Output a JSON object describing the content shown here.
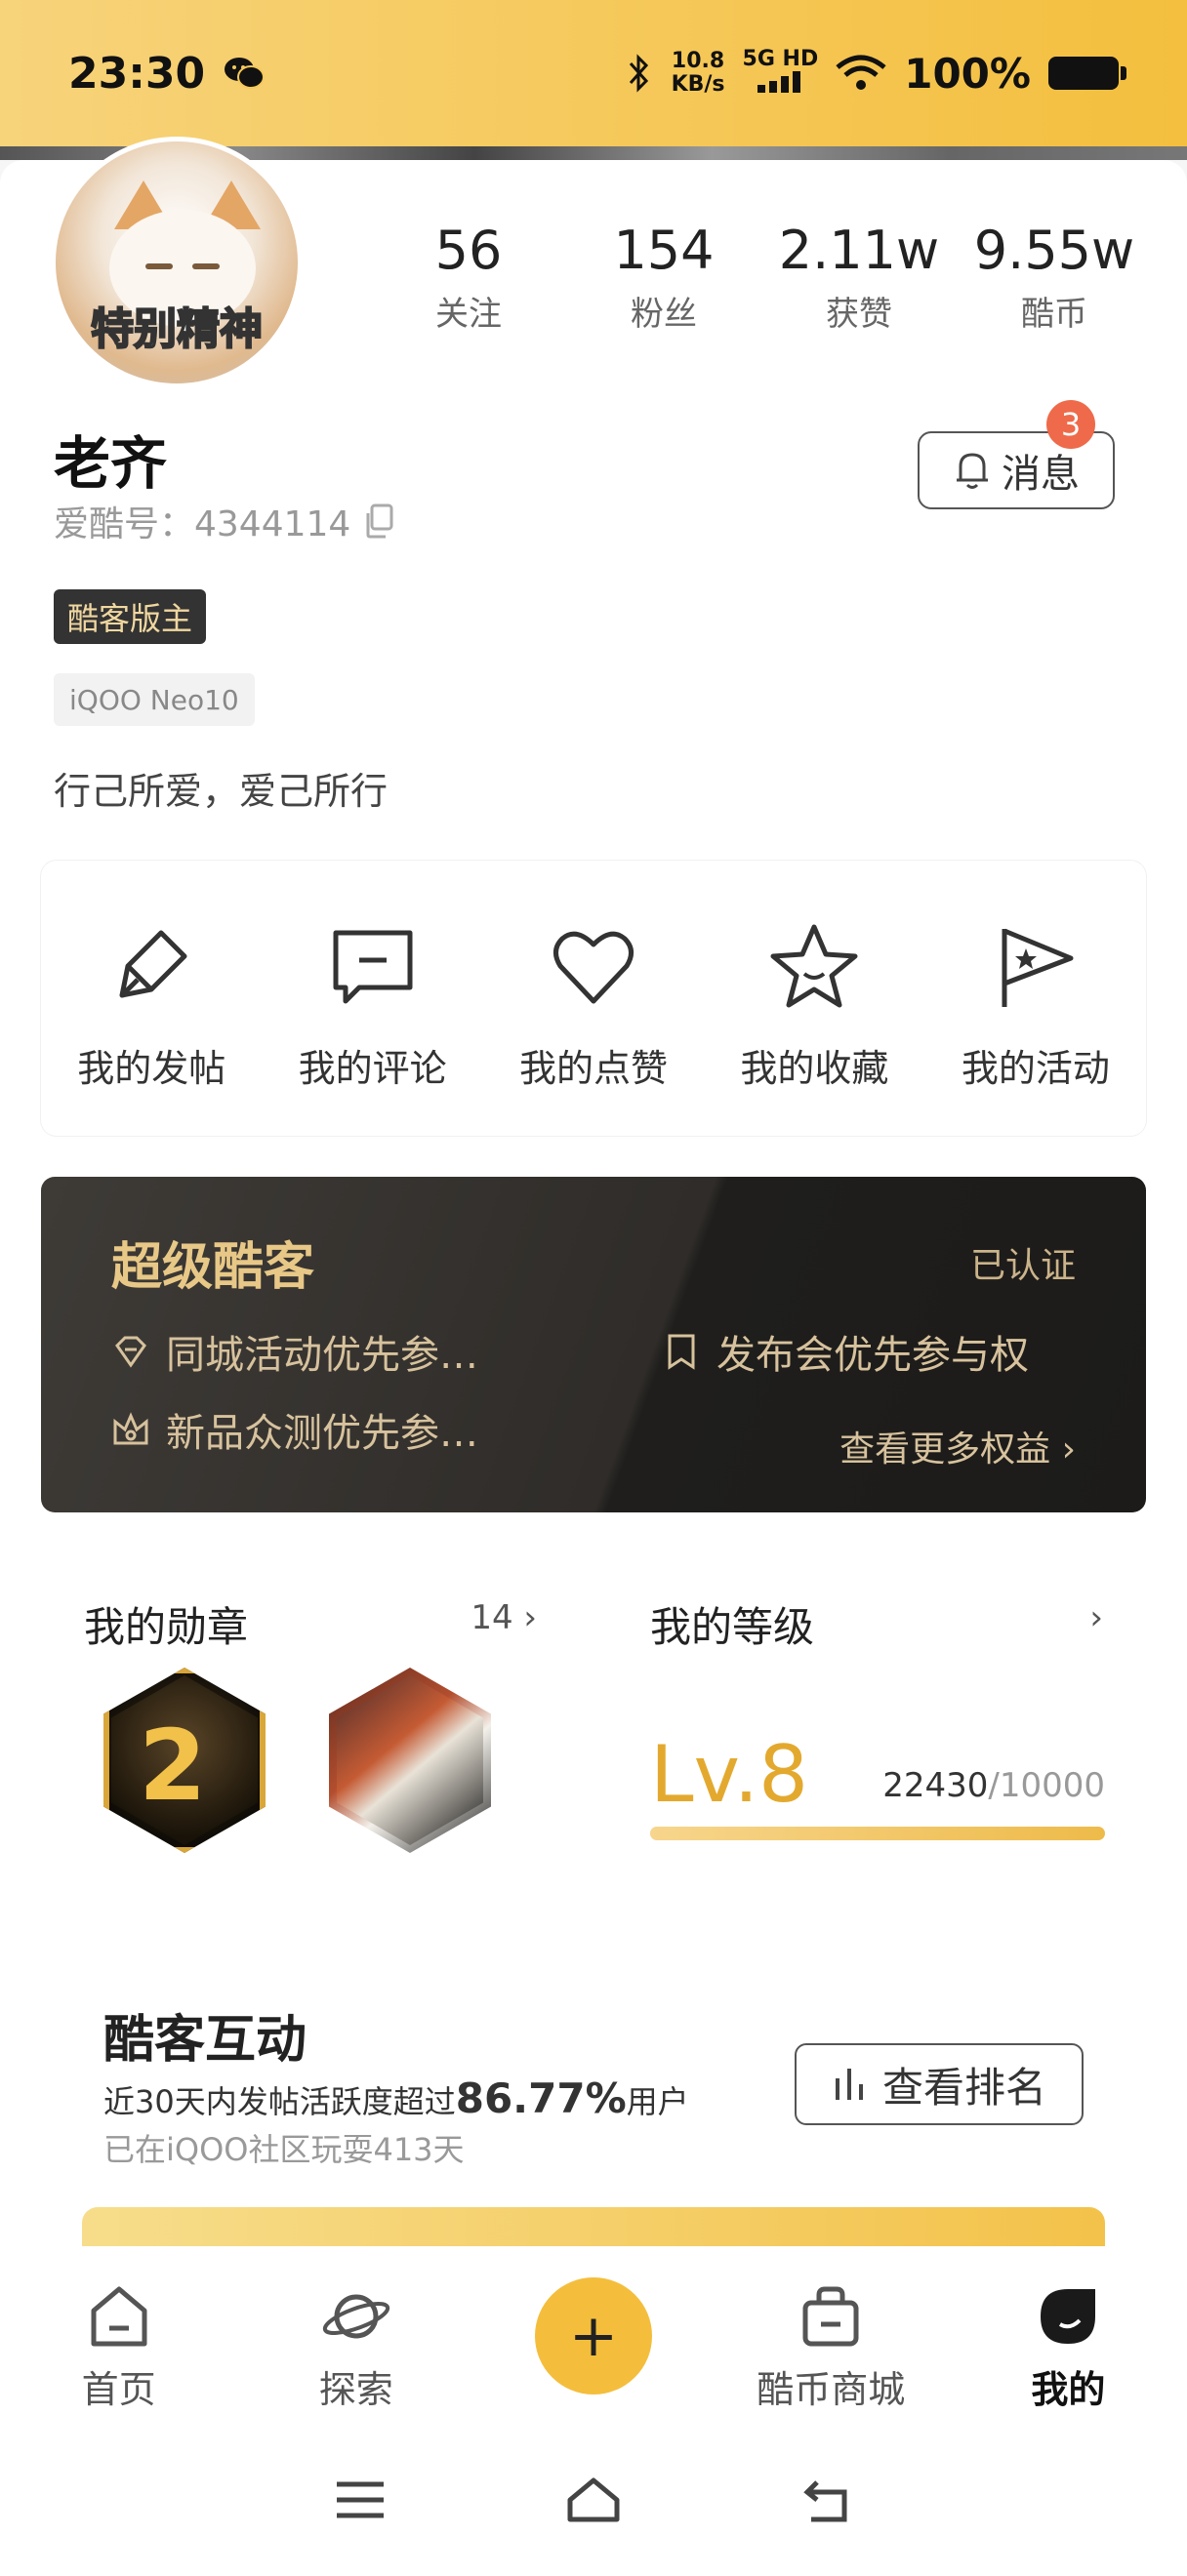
{
  "status_bar": {
    "time": "23:30",
    "net_speed_value": "10.8",
    "net_speed_unit": "KB/s",
    "signal_label": "5G HD",
    "battery": "100%"
  },
  "profile": {
    "avatar_caption": "特别精神",
    "username": "老齐",
    "user_id_label": "爱酷号：4344114",
    "role_tag": "酷客版主",
    "device_tag": "iQOO Neo10",
    "bio": "行己所爱，爱己所行",
    "message_button": "消息",
    "message_badge": "3"
  },
  "stats": [
    {
      "value": "56",
      "label": "关注"
    },
    {
      "value": "154",
      "label": "粉丝"
    },
    {
      "value": "2.11w",
      "label": "获赞"
    },
    {
      "value": "9.55w",
      "label": "酷币"
    }
  ],
  "actions": [
    {
      "label": "我的发帖",
      "icon": "pen-icon"
    },
    {
      "label": "我的评论",
      "icon": "comment-icon"
    },
    {
      "label": "我的点赞",
      "icon": "heart-icon"
    },
    {
      "label": "我的收藏",
      "icon": "star-icon"
    },
    {
      "label": "我的活动",
      "icon": "flag-icon"
    }
  ],
  "vip": {
    "title": "超级酷客",
    "verified": "已认证",
    "perks": [
      "同城活动优先参…",
      "发布会优先参与权",
      "新品众测优先参…"
    ],
    "more": "查看更多权益"
  },
  "medals": {
    "title": "我的勋章",
    "count": "14"
  },
  "level": {
    "title": "我的等级",
    "level": "Lv.8",
    "current_exp": "22430",
    "exp_total": "/10000",
    "progress": 1.0
  },
  "interaction": {
    "title": "酷客互动",
    "desc_prefix": "近30天内发帖活跃度超过",
    "desc_percent": "86.77%",
    "desc_suffix": "用户",
    "days": "已在iQOO社区玩耍413天",
    "rank_button": "查看排名"
  },
  "bottom_nav": [
    {
      "label": "首页",
      "icon": "home-icon"
    },
    {
      "label": "探索",
      "icon": "planet-icon"
    },
    {
      "label": "+",
      "icon": "plus-icon"
    },
    {
      "label": "酷币商城",
      "icon": "shop-bag-icon"
    },
    {
      "label": "我的",
      "icon": "profile-icon"
    }
  ],
  "colors": {
    "accent": "#f4be3c",
    "badge": "#ee6a4a",
    "vip_gold": "#e8c887"
  }
}
